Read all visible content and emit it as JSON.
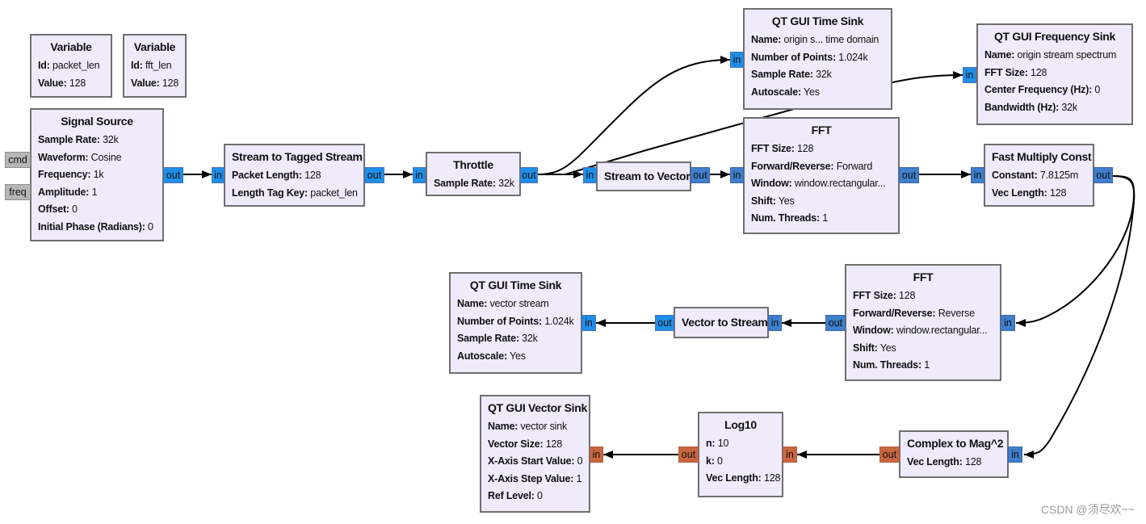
{
  "app": "GNU Radio Companion flowgraph",
  "colors": {
    "block_bg": "#efeafc",
    "block_border": "#6f6f6f",
    "port_float": "#1e8fe8",
    "port_complex_vector": "#3f7fcc",
    "port_float_vector": "#c8673f",
    "port_message": "#b7b7b7",
    "wire": "#000000"
  },
  "blocks": {
    "var_packet_len": {
      "title": "Variable",
      "params": [
        {
          "k": "Id:",
          "v": "packet_len"
        },
        {
          "k": "Value:",
          "v": "128"
        }
      ]
    },
    "var_fft_len": {
      "title": "Variable",
      "params": [
        {
          "k": "Id:",
          "v": "fft_len"
        },
        {
          "k": "Value:",
          "v": "128"
        }
      ]
    },
    "signal_source": {
      "title": "Signal Source",
      "params": [
        {
          "k": "Sample Rate:",
          "v": "32k"
        },
        {
          "k": "Waveform:",
          "v": "Cosine"
        },
        {
          "k": "Frequency:",
          "v": "1k"
        },
        {
          "k": "Amplitude:",
          "v": "1"
        },
        {
          "k": "Offset:",
          "v": "0"
        },
        {
          "k": "Initial Phase (Radians):",
          "v": "0"
        }
      ],
      "ports": {
        "cmd": "cmd",
        "freq": "freq",
        "out": "out"
      }
    },
    "stream_to_tagged": {
      "title": "Stream to Tagged Stream",
      "params": [
        {
          "k": "Packet Length:",
          "v": "128"
        },
        {
          "k": "Length Tag Key:",
          "v": "packet_len"
        }
      ],
      "ports": {
        "in": "in",
        "out": "out"
      }
    },
    "throttle": {
      "title": "Throttle",
      "params": [
        {
          "k": "Sample Rate:",
          "v": "32k"
        }
      ],
      "ports": {
        "in": "in",
        "out": "out"
      }
    },
    "time_sink_origin": {
      "title": "QT GUI Time Sink",
      "params": [
        {
          "k": "Name:",
          "v": "origin s... time domain"
        },
        {
          "k": "Number of Points:",
          "v": "1.024k"
        },
        {
          "k": "Sample Rate:",
          "v": "32k"
        },
        {
          "k": "Autoscale:",
          "v": "Yes"
        }
      ],
      "ports": {
        "in": "in"
      }
    },
    "freq_sink": {
      "title": "QT GUI Frequency Sink",
      "params": [
        {
          "k": "Name:",
          "v": "origin stream spectrum"
        },
        {
          "k": "FFT Size:",
          "v": "128"
        },
        {
          "k": "Center Frequency (Hz):",
          "v": "0"
        },
        {
          "k": "Bandwidth (Hz):",
          "v": "32k"
        }
      ],
      "ports": {
        "in": "in"
      }
    },
    "stream_to_vector": {
      "title": "Stream to Vector",
      "params": [],
      "ports": {
        "in": "in",
        "out": "out"
      }
    },
    "fft_forward": {
      "title": "FFT",
      "params": [
        {
          "k": "FFT Size:",
          "v": "128"
        },
        {
          "k": "Forward/Reverse:",
          "v": "Forward"
        },
        {
          "k": "Window:",
          "v": "window.rectangular..."
        },
        {
          "k": "Shift:",
          "v": "Yes"
        },
        {
          "k": "Num. Threads:",
          "v": "1"
        }
      ],
      "ports": {
        "in": "in",
        "out": "out"
      }
    },
    "fast_multiply": {
      "title": "Fast Multiply Const",
      "params": [
        {
          "k": "Constant:",
          "v": "7.8125m"
        },
        {
          "k": "Vec Length:",
          "v": "128"
        }
      ],
      "ports": {
        "in": "in",
        "out": "out"
      }
    },
    "fft_reverse": {
      "title": "FFT",
      "params": [
        {
          "k": "FFT Size:",
          "v": "128"
        },
        {
          "k": "Forward/Reverse:",
          "v": "Reverse"
        },
        {
          "k": "Window:",
          "v": "window.rectangular..."
        },
        {
          "k": "Shift:",
          "v": "Yes"
        },
        {
          "k": "Num. Threads:",
          "v": "1"
        }
      ],
      "ports": {
        "in": "in",
        "out": "out"
      }
    },
    "vector_to_stream": {
      "title": "Vector to Stream",
      "params": [],
      "ports": {
        "in": "in",
        "out": "out"
      }
    },
    "time_sink_vector": {
      "title": "QT GUI Time Sink",
      "params": [
        {
          "k": "Name:",
          "v": "vector stream"
        },
        {
          "k": "Number of Points:",
          "v": "1.024k"
        },
        {
          "k": "Sample Rate:",
          "v": "32k"
        },
        {
          "k": "Autoscale:",
          "v": "Yes"
        }
      ],
      "ports": {
        "in": "in"
      }
    },
    "complex_to_mag2": {
      "title": "Complex to Mag^2",
      "params": [
        {
          "k": "Vec Length:",
          "v": "128"
        }
      ],
      "ports": {
        "in": "in",
        "out": "out"
      }
    },
    "log10": {
      "title": "Log10",
      "params": [
        {
          "k": "n:",
          "v": "10"
        },
        {
          "k": "k:",
          "v": "0"
        },
        {
          "k": "Vec Length:",
          "v": "128"
        }
      ],
      "ports": {
        "in": "in",
        "out": "out"
      }
    },
    "vector_sink": {
      "title": "QT GUI Vector Sink",
      "params": [
        {
          "k": "Name:",
          "v": "vector sink"
        },
        {
          "k": "Vector Size:",
          "v": "128"
        },
        {
          "k": "X-Axis Start Value:",
          "v": "0"
        },
        {
          "k": "X-Axis Step Value:",
          "v": "1"
        },
        {
          "k": "Ref Level:",
          "v": "0"
        }
      ],
      "ports": {
        "in": "in"
      }
    }
  },
  "connections": [
    {
      "from": "signal_source.out",
      "to": "stream_to_tagged.in"
    },
    {
      "from": "stream_to_tagged.out",
      "to": "throttle.in"
    },
    {
      "from": "throttle.out",
      "to": "time_sink_origin.in"
    },
    {
      "from": "throttle.out",
      "to": "freq_sink.in"
    },
    {
      "from": "throttle.out",
      "to": "stream_to_vector.in"
    },
    {
      "from": "stream_to_vector.out",
      "to": "fft_forward.in"
    },
    {
      "from": "fft_forward.out",
      "to": "fast_multiply.in"
    },
    {
      "from": "fast_multiply.out",
      "to": "fft_reverse.in"
    },
    {
      "from": "fast_multiply.out",
      "to": "complex_to_mag2.in"
    },
    {
      "from": "fft_reverse.out",
      "to": "vector_to_stream.in"
    },
    {
      "from": "vector_to_stream.out",
      "to": "time_sink_vector.in"
    },
    {
      "from": "complex_to_mag2.out",
      "to": "log10.in"
    },
    {
      "from": "log10.out",
      "to": "vector_sink.in"
    }
  ],
  "watermark": "CSDN @须尽欢~~"
}
